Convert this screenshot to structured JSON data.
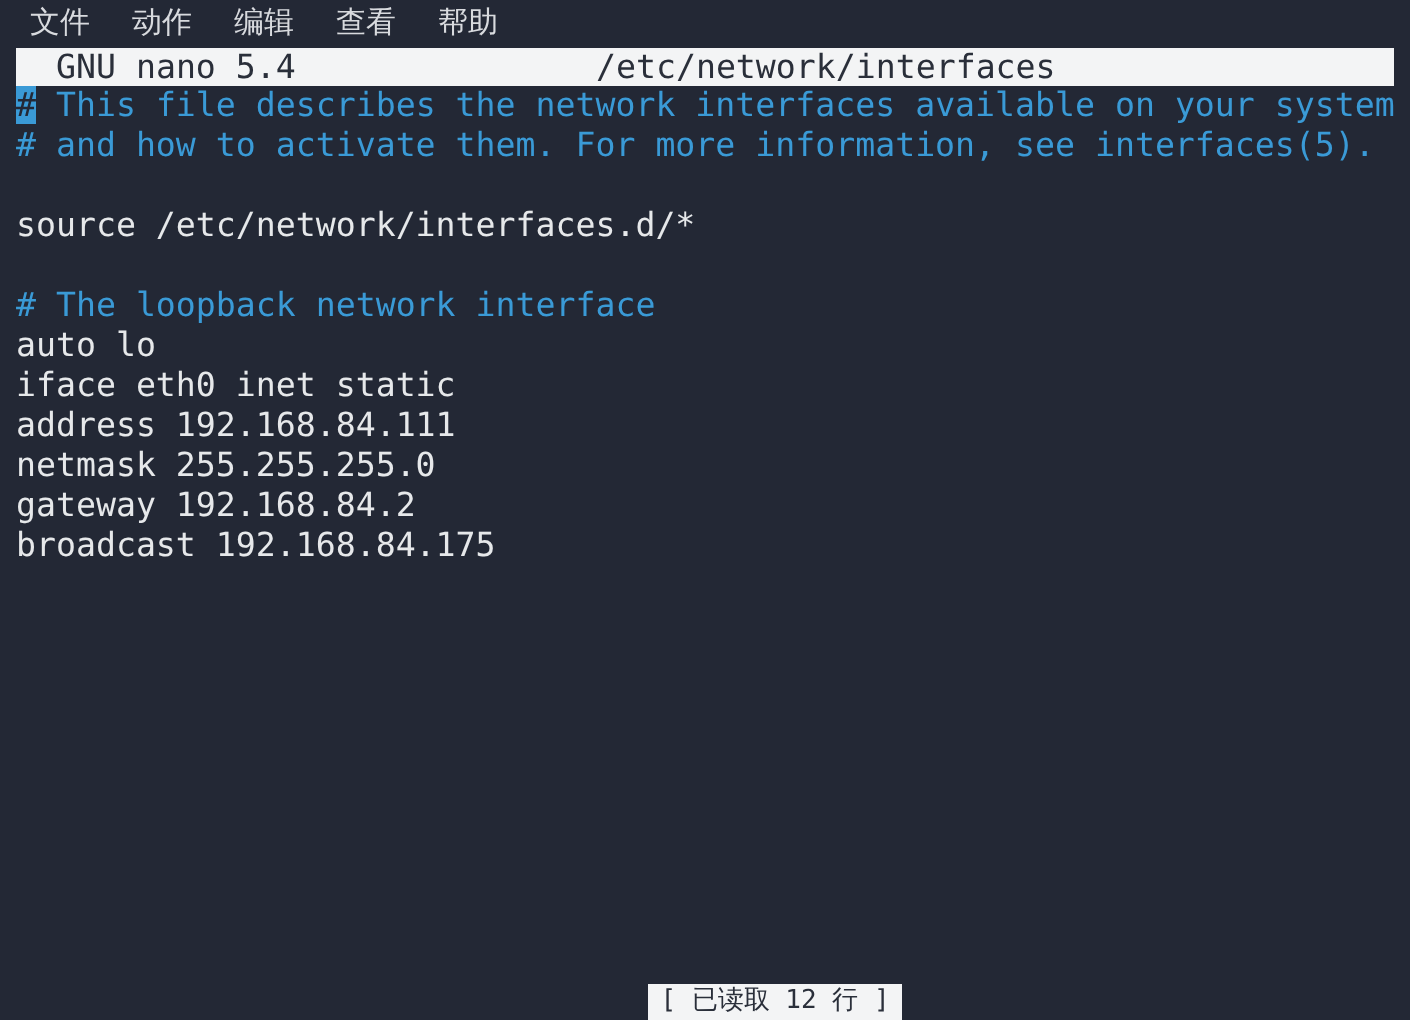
{
  "menu_bar": {
    "items": [
      {
        "label": "文件"
      },
      {
        "label": "动作"
      },
      {
        "label": "编辑"
      },
      {
        "label": "查看"
      },
      {
        "label": "帮助"
      }
    ]
  },
  "title_bar": {
    "app": "GNU nano 5.4",
    "file": "/etc/network/interfaces"
  },
  "lines": [
    {
      "kind": "comment",
      "text": "# This file describes the network interfaces available on your system",
      "cursor_at_start": true
    },
    {
      "kind": "comment",
      "text": "# and how to activate them. For more information, see interfaces(5).",
      "cursor_at_start": false
    },
    {
      "kind": "blank"
    },
    {
      "kind": "code",
      "text": "source /etc/network/interfaces.d/*",
      "cursor_at_start": false
    },
    {
      "kind": "blank"
    },
    {
      "kind": "comment",
      "text": "# The loopback network interface",
      "cursor_at_start": false
    },
    {
      "kind": "code",
      "text": "auto lo",
      "cursor_at_start": false
    },
    {
      "kind": "code",
      "text": "iface eth0 inet static",
      "cursor_at_start": false
    },
    {
      "kind": "code",
      "text": "address 192.168.84.111",
      "cursor_at_start": false
    },
    {
      "kind": "code",
      "text": "netmask 255.255.255.0",
      "cursor_at_start": false
    },
    {
      "kind": "code",
      "text": "gateway 192.168.84.2",
      "cursor_at_start": false
    },
    {
      "kind": "code",
      "text": "broadcast 192.168.84.175",
      "cursor_at_start": false
    }
  ],
  "status_bar": {
    "message": "[ 已读取 12 行 ]"
  }
}
